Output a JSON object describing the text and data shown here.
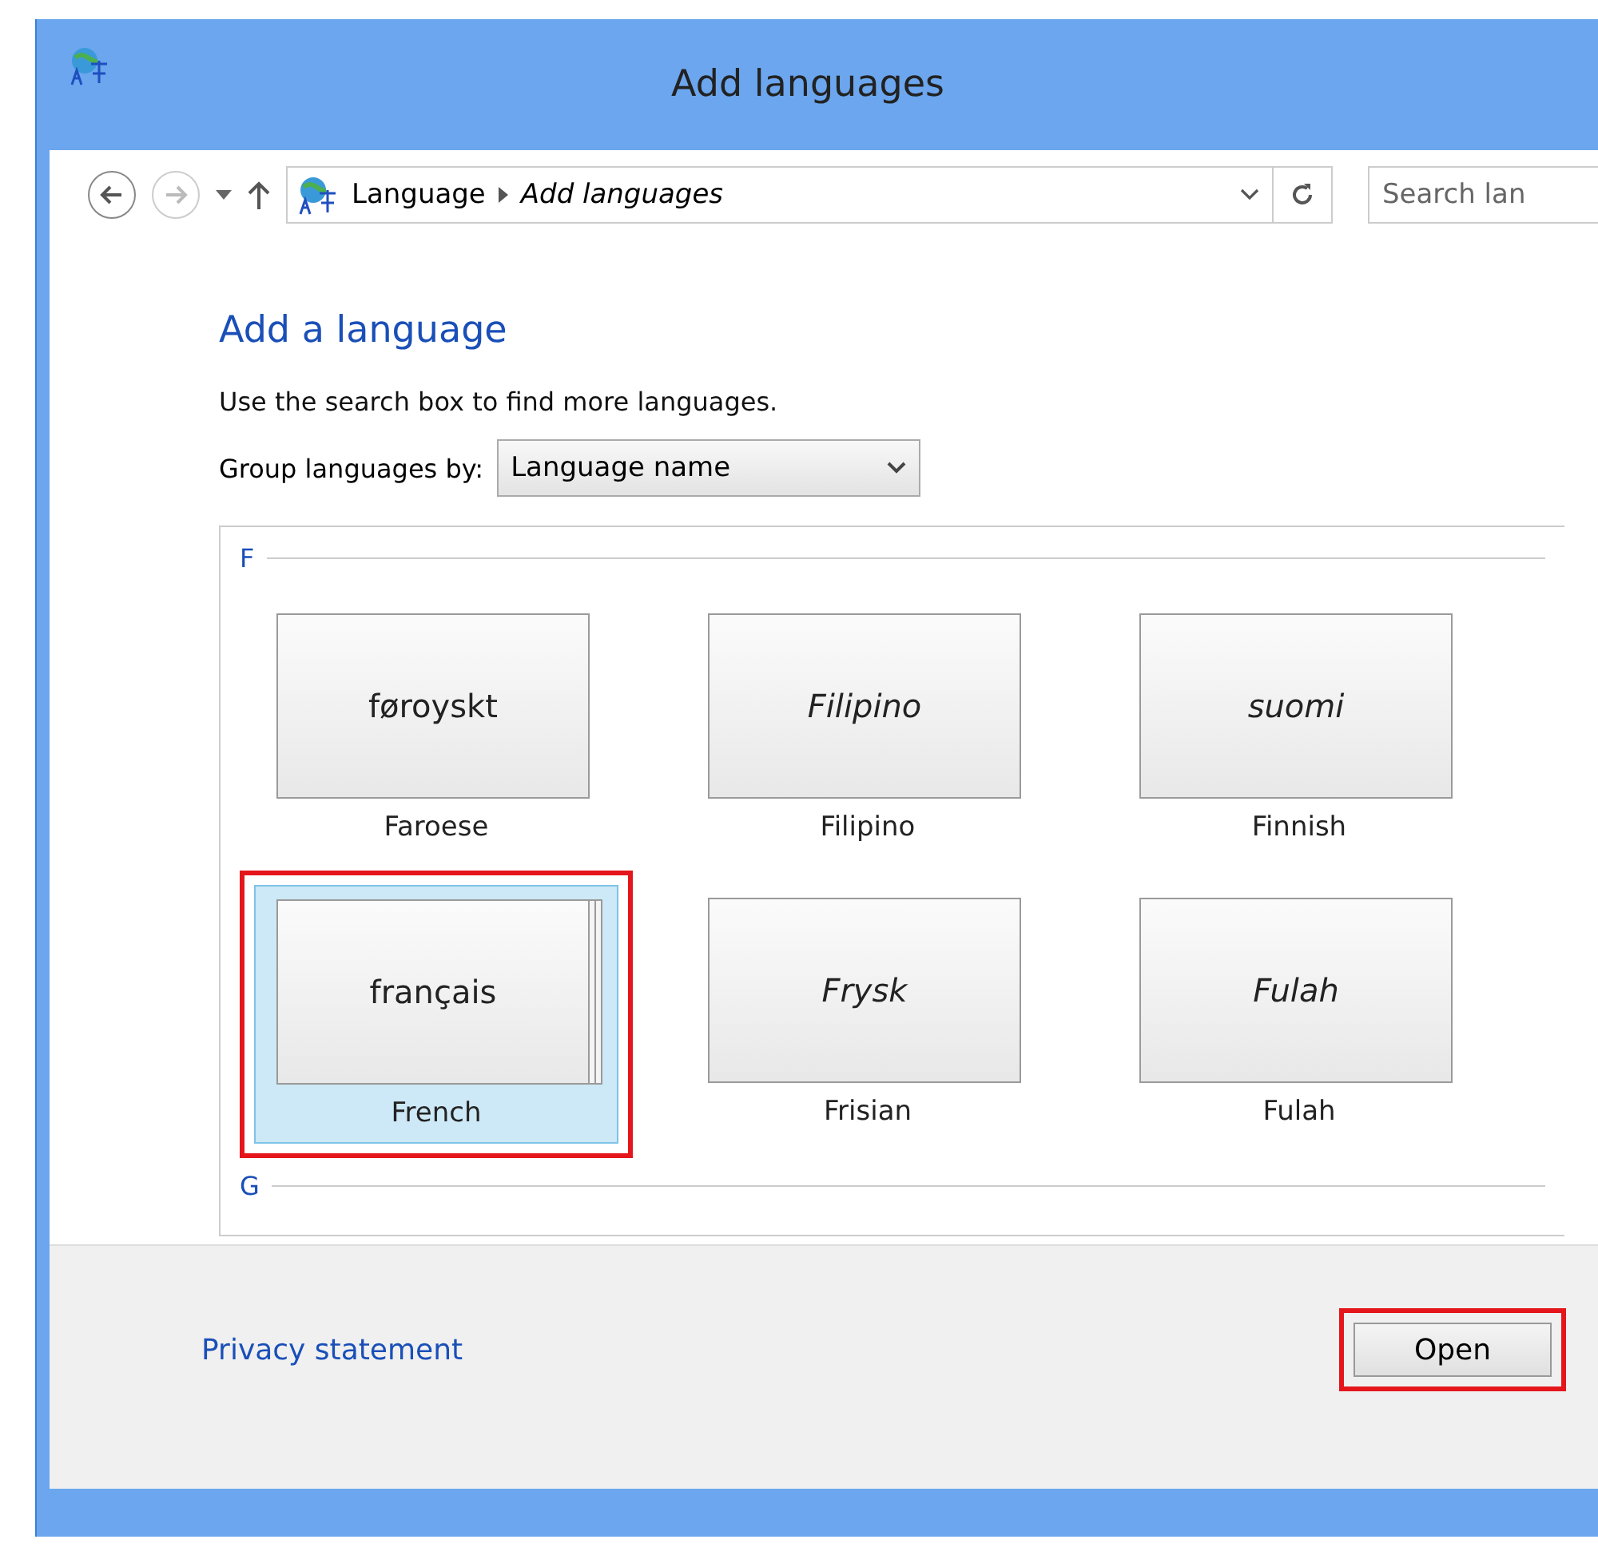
{
  "window": {
    "title": "Add languages"
  },
  "address_bar": {
    "crumbs": [
      "Language",
      "Add languages"
    ]
  },
  "search": {
    "placeholder": "Search lan"
  },
  "heading": "Add a language",
  "hint": "Use the search box to find more languages.",
  "group_by": {
    "label": "Group languages by:",
    "value": "Language name"
  },
  "groups": [
    {
      "letter": "F",
      "languages": [
        {
          "native": "føroyskt",
          "name": "Faroese",
          "italic": false,
          "selected": false,
          "highlighted": false,
          "variants": false
        },
        {
          "native": "Filipino",
          "name": "Filipino",
          "italic": true,
          "selected": false,
          "highlighted": false,
          "variants": false
        },
        {
          "native": "suomi",
          "name": "Finnish",
          "italic": true,
          "selected": false,
          "highlighted": false,
          "variants": false
        },
        {
          "native": "français",
          "name": "French",
          "italic": false,
          "selected": true,
          "highlighted": true,
          "variants": true
        },
        {
          "native": "Frysk",
          "name": "Frisian",
          "italic": true,
          "selected": false,
          "highlighted": false,
          "variants": false
        },
        {
          "native": "Fulah",
          "name": "Fulah",
          "italic": true,
          "selected": false,
          "highlighted": false,
          "variants": false
        }
      ]
    },
    {
      "letter": "G"
    }
  ],
  "footer": {
    "link": "Privacy statement",
    "button": {
      "label": "Open",
      "highlighted": true
    }
  }
}
